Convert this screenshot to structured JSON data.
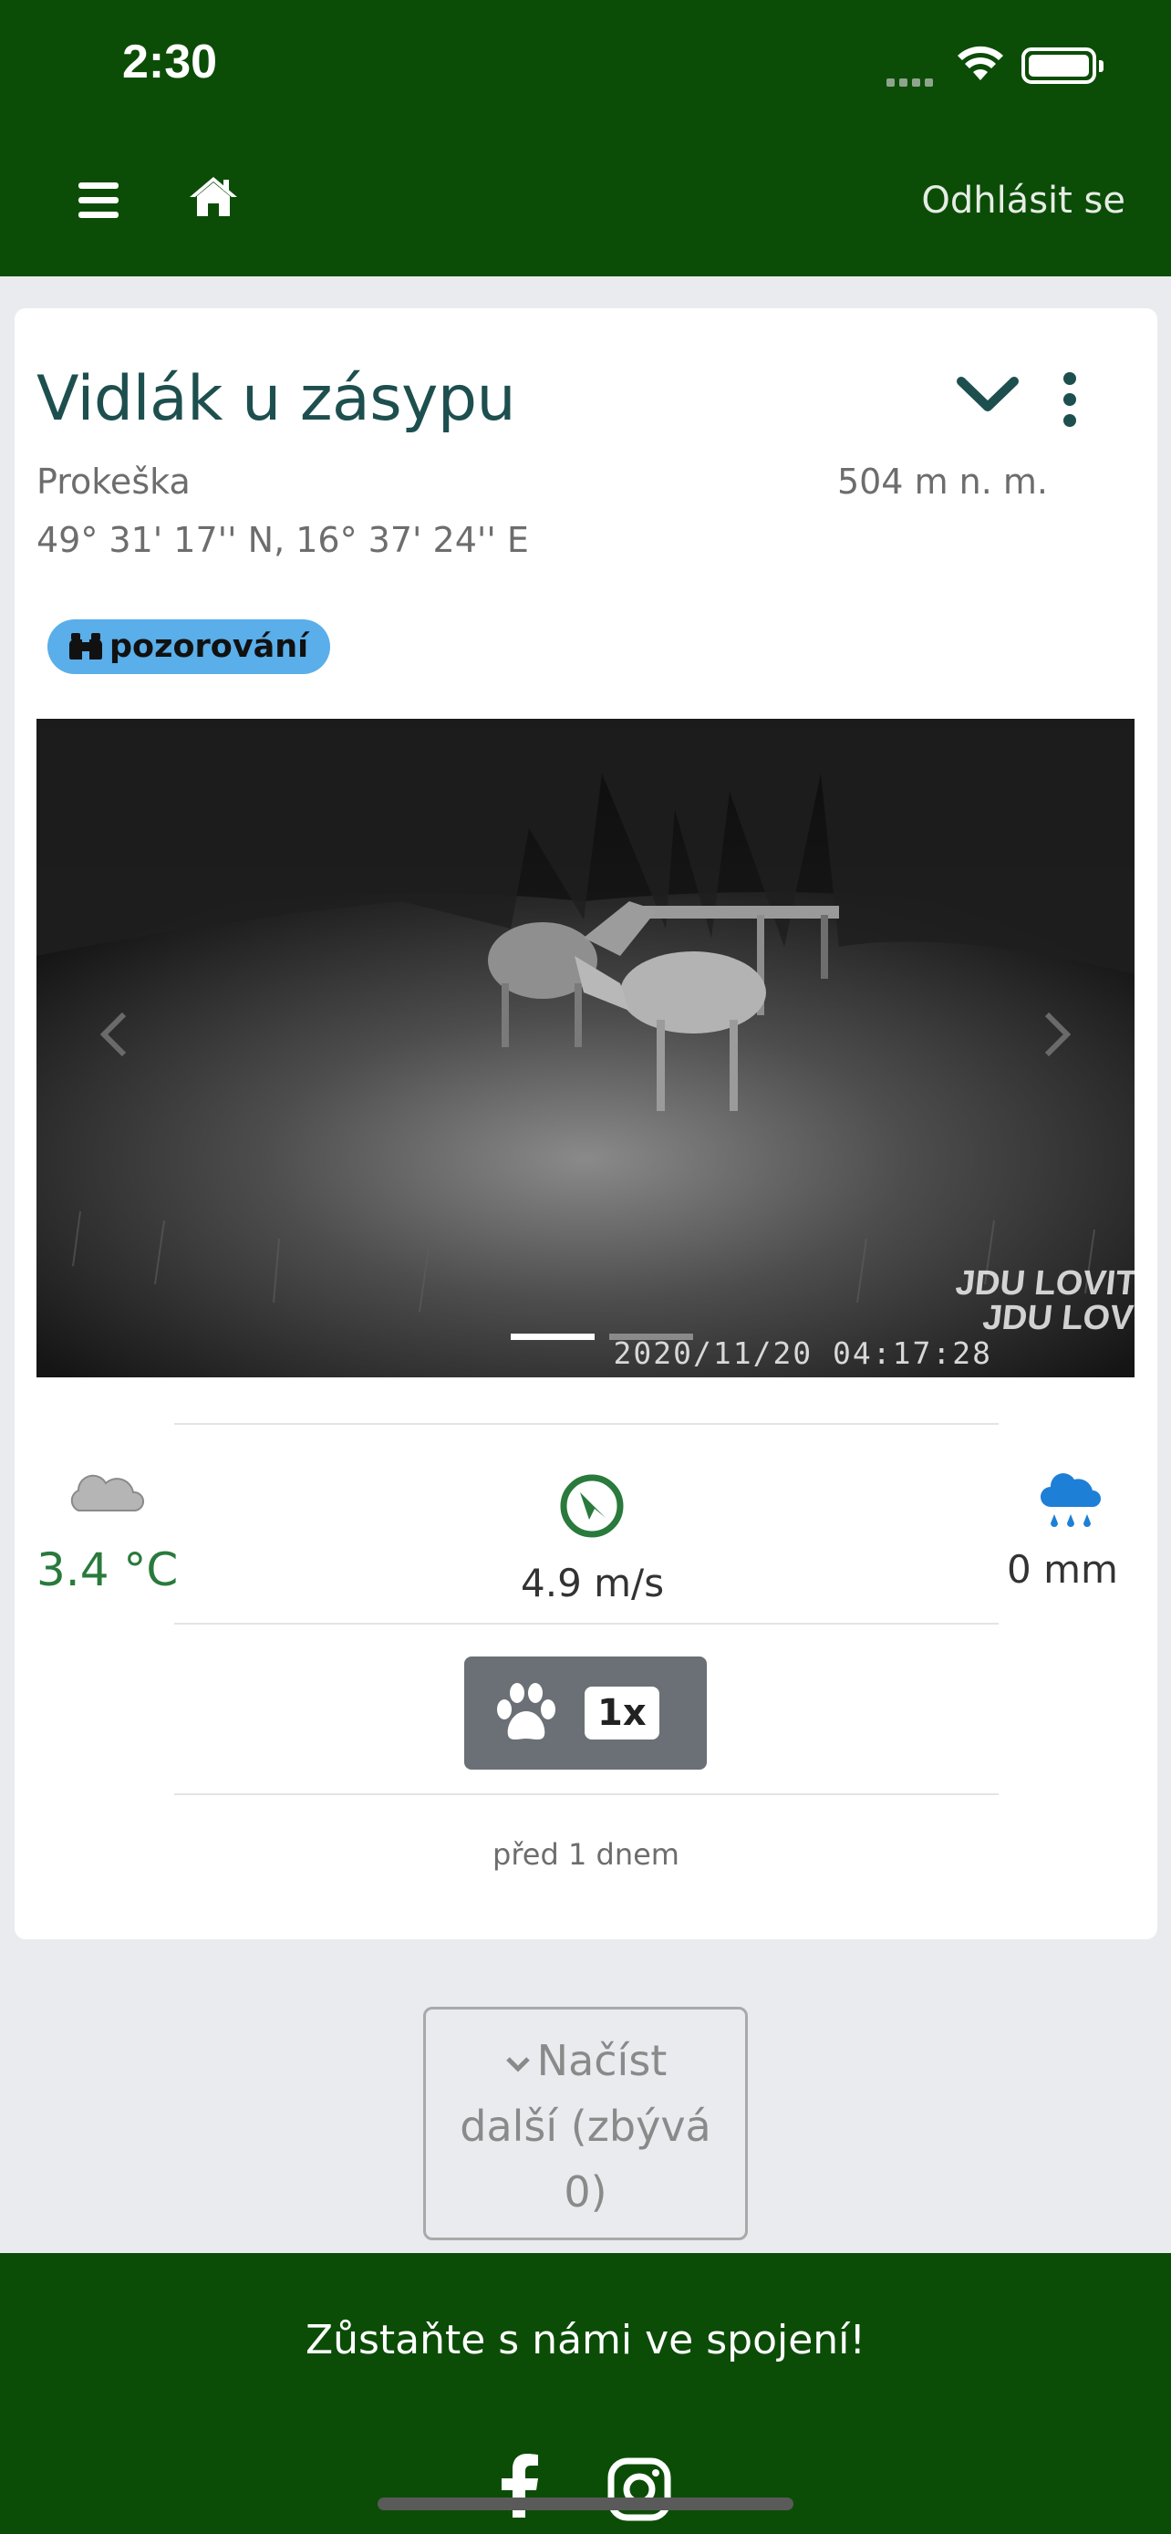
{
  "status_bar": {
    "time": "2:30"
  },
  "header": {
    "logout_label": "Odhlásit se"
  },
  "card": {
    "title": "Vidlák u zásypu",
    "owner": "Prokeška",
    "altitude": "504 m n. m.",
    "coordinates": "49° 31' 17'' N, 16° 37' 24'' E",
    "badge": {
      "label": "pozorování",
      "icon": "binoculars-icon",
      "color": "#5aaee9"
    },
    "photo": {
      "timestamp": "2020/11/20 04:17:28",
      "watermark_line1": "JDU LOVIT",
      "watermark_line2": "JDU LOV",
      "slides_total": 2,
      "active_slide": 1
    },
    "weather": {
      "temperature": "3.4 °C",
      "wind": "4.9 m/s",
      "precipitation": "0 mm"
    },
    "animals": {
      "icon": "paw-icon",
      "count": "1x"
    },
    "time_ago": "před 1 dnem"
  },
  "load_more": {
    "line1": "Načíst",
    "line2": "další (zbývá",
    "line3": "0)"
  },
  "footer": {
    "text": "Zůstaňte s námi ve spojení!"
  },
  "colors": {
    "brand_green": "#0b4d06",
    "title_teal": "#1e4f4f",
    "temp_green": "#297a3c",
    "rain_blue": "#1e7fd6"
  }
}
